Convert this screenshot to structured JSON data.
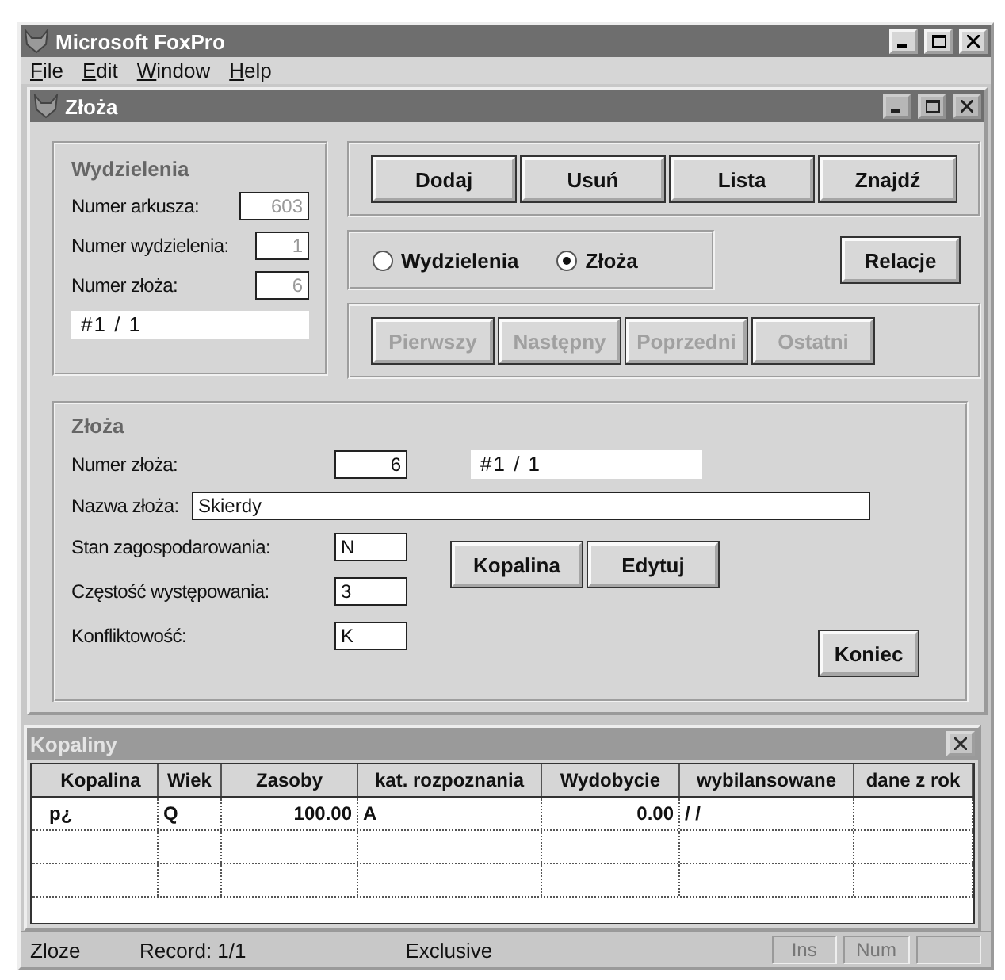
{
  "app": {
    "title": "Microsoft FoxPro"
  },
  "menu": [
    {
      "label": "File"
    },
    {
      "label": "Edit"
    },
    {
      "label": "Window"
    },
    {
      "label": "Help"
    }
  ],
  "form": {
    "title": "Złoża",
    "wydzielenia": {
      "title": "Wydzielenia",
      "record": "#1 / 1",
      "fields": [
        {
          "label": "Numer arkusza:",
          "value": "603",
          "disabled": true
        },
        {
          "label": "Numer wydzielenia:",
          "value": "1",
          "disabled": true
        },
        {
          "label": "Numer złoża:",
          "value": "6",
          "disabled": true
        }
      ]
    },
    "actions": [
      {
        "label": "Dodaj"
      },
      {
        "label": "Usuń"
      },
      {
        "label": "Lista"
      },
      {
        "label": "Znajdź"
      }
    ],
    "mode": [
      {
        "label": "Wydzielenia",
        "selected": false
      },
      {
        "label": "Złoża",
        "selected": true
      }
    ],
    "relations_button": "Relacje",
    "navigation": [
      {
        "label": "Pierwszy",
        "disabled": true
      },
      {
        "label": "Następny",
        "disabled": true
      },
      {
        "label": "Poprzedni",
        "disabled": true
      },
      {
        "label": "Ostatni",
        "disabled": true
      }
    ],
    "zloza": {
      "title": "Złoża",
      "number_label": "Numer złoża:",
      "number_value": "6",
      "record": "#1 / 1",
      "name_label": "Nazwa złoża:",
      "name_value": "Skierdy",
      "fields": [
        {
          "label": "Stan zagospodarowania:",
          "value": "N"
        },
        {
          "label": "Częstość występowania:",
          "value": "3"
        },
        {
          "label": "Konfliktowość:",
          "value": "K"
        }
      ],
      "buttons": [
        {
          "label": "Kopalina"
        },
        {
          "label": "Edytuj"
        }
      ],
      "end_button": "Koniec"
    }
  },
  "grid": {
    "title": "Kopaliny",
    "columns": [
      {
        "label": "Kopalina",
        "kind": "text"
      },
      {
        "label": "Wiek",
        "kind": "text"
      },
      {
        "label": "Zasoby",
        "kind": "number"
      },
      {
        "label": "kat. rozpoznania",
        "kind": "text"
      },
      {
        "label": "Wydobycie",
        "kind": "number"
      },
      {
        "label": "wybilansowane",
        "kind": "text"
      },
      {
        "label": "dane z rok",
        "kind": "text"
      }
    ],
    "rows": [
      [
        "p¿",
        "Q",
        "100.00",
        "A",
        "0.00",
        "/ /",
        ""
      ]
    ]
  },
  "status_bar": {
    "texts": [
      "Zloze",
      "Record: 1/1",
      "Exclusive"
    ],
    "indicators": [
      "Ins",
      "Num"
    ]
  }
}
